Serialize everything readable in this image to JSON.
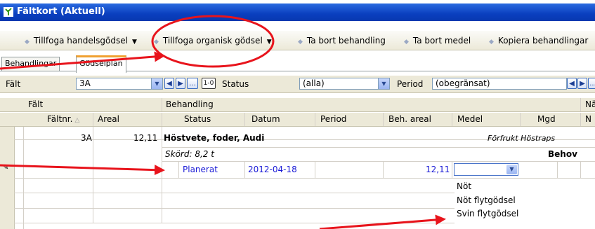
{
  "window": {
    "title": "Fältkort (Aktuell)"
  },
  "toolbar": {
    "items": [
      {
        "label": "Tillfoga handelsgödsel",
        "has_dropdown": true
      },
      {
        "label": "Tillfoga organisk gödsel",
        "has_dropdown": true
      },
      {
        "label": "Ta bort behandling",
        "has_dropdown": false
      },
      {
        "label": "Ta bort medel",
        "has_dropdown": false
      },
      {
        "label": "Kopiera behandlingar",
        "has_dropdown": false
      }
    ]
  },
  "tabs": [
    {
      "label": "Behandlingar"
    },
    {
      "label": "Gödselplan"
    }
  ],
  "filter": {
    "falt_label": "Fält",
    "falt_value": "3A",
    "status_label": "Status",
    "status_value": "(alla)",
    "period_label": "Period",
    "period_value": "(obegränsat)",
    "ellipsis": "...",
    "reset": "1-0"
  },
  "grid": {
    "group_header": {
      "falt": "Fält",
      "behandling": "Behandling",
      "extra": "Nä"
    },
    "columns": {
      "faltnr": "Fältnr.",
      "areal": "Areal",
      "status": "Status",
      "datum": "Datum",
      "period": "Period",
      "beh_areal": "Beh. areal",
      "medel": "Medel",
      "mgd": "Mgd",
      "n": "N"
    },
    "field_row": {
      "faltnr": "3A",
      "areal": "12,11",
      "crop": "Höstvete, foder, Audi",
      "forfrukt": "Förfrukt Höstraps"
    },
    "harvest_row": {
      "skord": "Skörd: 8,2 t",
      "behov": "Behov"
    },
    "treatment_row": {
      "status": "Planerat",
      "datum": "2012-04-18",
      "beh_areal": "12,11",
      "medel": ""
    }
  },
  "medel_dropdown": {
    "options": [
      "Nöt",
      "Nöt flytgödsel",
      "Svin flytgödsel"
    ]
  },
  "colors": {
    "title_bar": "#0a3fbf",
    "annotation": "#e8141c",
    "planned_text": "#1a1ad6",
    "active_tab_accent": "#f0a030"
  }
}
